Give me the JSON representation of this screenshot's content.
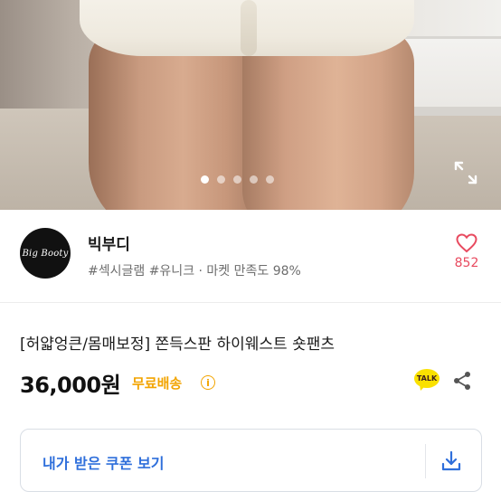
{
  "gallery": {
    "image_alt": "",
    "dot_count": 5,
    "active_index": 0,
    "expand_icon": "expand-icon"
  },
  "seller": {
    "avatar_text": "Big Booty",
    "name": "빅부디",
    "tags": "#섹시글램 #유니크 · 마켓 만족도 98%",
    "like_icon": "heart-outline-icon",
    "like_count": "852"
  },
  "product": {
    "title": "[허얇엉큰/몸매보정] 쫀득스판 하이웨스트 숏팬츠",
    "price": "36,000원",
    "shipping": "무료배송",
    "info_icon_text": "i",
    "talk_label": "TALK",
    "share_icon": "share-icon"
  },
  "coupon": {
    "label": "내가 받은 쿠폰 보기",
    "download_icon": "download-icon"
  },
  "colors": {
    "shipping": "#f2a400",
    "like": "#e84a5f",
    "coupon_text": "#2f6fdb",
    "talk_bg": "#fae100"
  }
}
